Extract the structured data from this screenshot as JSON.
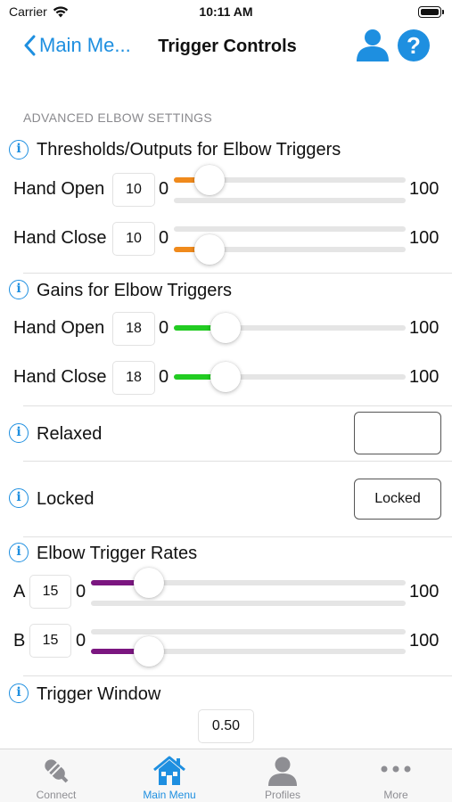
{
  "status_bar": {
    "carrier": "Carrier",
    "time": "10:11 AM"
  },
  "nav": {
    "back_label": "Main Me...",
    "title": "Trigger Controls"
  },
  "section_caption": "ADVANCED ELBOW SETTINGS",
  "thresholds": {
    "heading": "Thresholds/Outputs for Elbow Triggers",
    "rows": [
      {
        "label": "Hand Open",
        "value": "10",
        "min": "0",
        "max": "100",
        "level": 0.1
      },
      {
        "label": "Hand Close",
        "value": "10",
        "min": "0",
        "max": "100",
        "level": 0.1
      }
    ],
    "accent": "#f08a1c"
  },
  "gains": {
    "heading": "Gains for Elbow Triggers",
    "rows": [
      {
        "label": "Hand Open",
        "value": "18",
        "min": "0",
        "max": "100",
        "level": 0.18
      },
      {
        "label": "Hand Close",
        "value": "18",
        "min": "0",
        "max": "100",
        "level": 0.18
      }
    ],
    "accent": "#22cc22"
  },
  "relaxed": {
    "label": "Relaxed",
    "button_text": ""
  },
  "locked": {
    "label": "Locked",
    "button_text": "Locked"
  },
  "rates": {
    "heading": "Elbow Trigger Rates",
    "rows": [
      {
        "label": "A",
        "value": "15",
        "min": "0",
        "max": "100",
        "level": 0.15
      },
      {
        "label": "B",
        "value": "15",
        "min": "0",
        "max": "100",
        "level": 0.15
      }
    ],
    "accent": "#7b1680"
  },
  "trigger_window": {
    "heading": "Trigger Window",
    "value": "0.50"
  },
  "tabs": [
    {
      "label": "Connect",
      "icon": "connect-icon",
      "active": false
    },
    {
      "label": "Main Menu",
      "icon": "home-icon",
      "active": true
    },
    {
      "label": "Profiles",
      "icon": "profile-icon",
      "active": false
    },
    {
      "label": "More",
      "icon": "more-icon",
      "active": false
    }
  ],
  "colors": {
    "tint": "#1e8fe0",
    "inactive_tab": "#8e8e93"
  }
}
